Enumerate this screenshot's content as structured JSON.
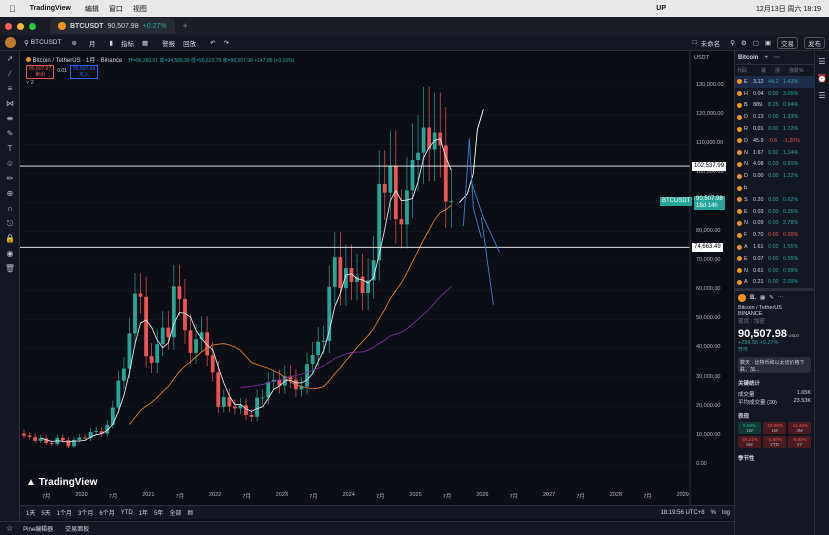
{
  "menubar": {
    "app": "TradingView",
    "items": [
      "编辑",
      "窗口",
      "视图"
    ],
    "status_up": "UP",
    "date_time": "12月13日 周六 18:19"
  },
  "tab": {
    "symbol": "BTCUSDT",
    "price": "90,507.98",
    "change": "+0.27%"
  },
  "toolbar": {
    "symbol": "BTCUSDT",
    "interval": "月",
    "indicators": "指标",
    "alert": "警报",
    "replay": "回放",
    "layout_name": "未命名",
    "trade_button": "交易",
    "publish_button": "发布"
  },
  "legend": {
    "title": "Bitcoin / TetherUS · 1月 · Binance",
    "ohlc": "开=90,360.01 高=94,588.99 低=90,622.76 收=90,507.98 +147.98 (+0.16%)",
    "sell_price": "90,507.97",
    "sell_label": "卖出",
    "spread": "0.01",
    "buy_price": "90,507.98",
    "buy_label": "买入",
    "indicator_count": "2"
  },
  "price_axis": {
    "currency": "USDT",
    "labels": [
      "130,000.00",
      "120,000.00",
      "110,000.00",
      "100,000.00",
      "90,000.00",
      "80,000.00",
      "70,000.00",
      "60,000.00",
      "50,000.00",
      "40,000.00",
      "30,000.00",
      "20,000.00",
      "10,000.00",
      "0.00"
    ],
    "line1": "102,537.99",
    "line2": "74,663.49",
    "current_symbol": "BTCUSDT",
    "current_price": "90,507.98",
    "countdown": "18d 14h"
  },
  "time_axis": [
    "7月",
    "2020",
    "7月",
    "2021",
    "7月",
    "2022",
    "7月",
    "2023",
    "7月",
    "2024",
    "7月",
    "2025",
    "7月",
    "2026",
    "7月",
    "2027",
    "7月",
    "2028",
    "7月",
    "2029"
  ],
  "watermark": "TradingView",
  "bottombar": {
    "ranges": [
      "1天",
      "5天",
      "1个月",
      "3个月",
      "6个月",
      "YTD",
      "1年",
      "5年",
      "全部"
    ],
    "time": "18:19:56 UTC+8"
  },
  "statusbar": {
    "pine": "Pine编辑器",
    "trading": "交易面板"
  },
  "watchlist": {
    "header": [
      "代码",
      "最",
      "涨",
      "涨跌%"
    ],
    "title": "Bitcoin",
    "rows": [
      {
        "s": "E",
        "p": "3,12",
        "c": "44.2",
        "pct": "1.43%",
        "up": true
      },
      {
        "s": "H",
        "p": "0.04",
        "c": "0.00",
        "pct": "3.05%",
        "up": true
      },
      {
        "s": "B",
        "p": "889.",
        "c": "8.25",
        "pct": "0.94%",
        "up": true
      },
      {
        "s": "D",
        "p": "0.13",
        "c": "0.00",
        "pct": "1.33%",
        "up": true
      },
      {
        "s": "R",
        "p": "0.01",
        "c": "0.00",
        "pct": "1.72%",
        "up": true
      },
      {
        "s": "D",
        "p": "45.9",
        "c": "-0.6",
        "pct": "-1.20%",
        "up": false
      },
      {
        "s": "N",
        "p": "1.67",
        "c": "0.02",
        "pct": "1.14%",
        "up": true
      },
      {
        "s": "N",
        "p": "4.08",
        "c": "0.03",
        "pct": "0.91%",
        "up": true
      },
      {
        "s": "D",
        "p": "0.00",
        "c": "0.00",
        "pct": "1.22%",
        "up": true
      },
      {
        "s": "b",
        "p": "",
        "c": "",
        "pct": "",
        "up": true
      },
      {
        "s": "S",
        "p": "0.20",
        "c": "0.00",
        "pct": "0.62%",
        "up": true
      },
      {
        "s": "E",
        "p": "0.03",
        "c": "0.00",
        "pct": "0.35%",
        "up": true
      },
      {
        "s": "N",
        "p": "0.09",
        "c": "0.00",
        "pct": "2.78%",
        "up": true
      },
      {
        "s": "F",
        "p": "0.70",
        "c": "0.00",
        "pct": "0.00%",
        "up": false
      },
      {
        "s": "A",
        "p": "1.61",
        "c": "0.02",
        "pct": "1.55%",
        "up": true
      },
      {
        "s": "E",
        "p": "0.07",
        "c": "0.00",
        "pct": "0.55%",
        "up": true
      },
      {
        "s": "N",
        "p": "0.61",
        "c": "0.00",
        "pct": "0.99%",
        "up": true
      },
      {
        "s": "A",
        "p": "0.21",
        "c": "0.00",
        "pct": "2.09%",
        "up": true
      }
    ]
  },
  "details": {
    "symbol": "B.",
    "name": "Bitcoin / TetherUS",
    "exchange": "BINANCE",
    "tags": "现货 · 加密",
    "price": "90,507.98",
    "unit": "USDT",
    "change": "+239.56",
    "change_pct": "+0.27%",
    "status": "开市",
    "news": "数天 · 比特币和以太坊价格下跌，加...",
    "key_stats": "关键统计",
    "volume_label": "成交量",
    "volume": "1.65K",
    "avg_volume_label": "平均成交量 (30)",
    "avg_volume": "23.53K",
    "performance": "表现",
    "perf": [
      {
        "v": "5.69%",
        "l": "1W",
        "up": true
      },
      {
        "v": "-18.96%",
        "l": "1M",
        "up": false
      },
      {
        "v": "-21.46%",
        "l": "3M",
        "up": false
      },
      {
        "v": "-16.21%",
        "l": "6M",
        "up": false
      },
      {
        "v": "-3.80%",
        "l": "YTD",
        "up": false
      },
      {
        "v": "-9.92%",
        "l": "1Y",
        "up": false
      }
    ],
    "seasonality": "季节性"
  },
  "colors": {
    "up": "#26a69a",
    "down": "#ef5350",
    "ma_white": "#e0e3eb",
    "ma_orange": "#e07b24",
    "ma_purple": "#7b2c9c",
    "arrow": "#3a7fd5"
  },
  "chart_data": {
    "type": "candlestick",
    "interval": "1M",
    "candles": [
      {
        "t": "2019-07",
        "o": 10800,
        "c": 10080
      },
      {
        "t": "2019-08",
        "o": 10080,
        "c": 9600
      },
      {
        "t": "2019-09",
        "o": 9600,
        "c": 8290
      },
      {
        "t": "2019-10",
        "o": 8290,
        "c": 9150
      },
      {
        "t": "2019-11",
        "o": 9150,
        "c": 7540
      },
      {
        "t": "2019-12",
        "o": 7540,
        "c": 7190
      },
      {
        "t": "2020-01",
        "o": 7190,
        "c": 9350
      },
      {
        "t": "2020-02",
        "o": 9350,
        "c": 8520
      },
      {
        "t": "2020-03",
        "o": 8520,
        "c": 6410
      },
      {
        "t": "2020-04",
        "o": 6410,
        "c": 8620
      },
      {
        "t": "2020-05",
        "o": 8620,
        "c": 9450
      },
      {
        "t": "2020-06",
        "o": 9450,
        "c": 9140
      },
      {
        "t": "2020-07",
        "o": 9140,
        "c": 11340
      },
      {
        "t": "2020-08",
        "o": 11340,
        "c": 11650
      },
      {
        "t": "2020-09",
        "o": 11650,
        "c": 10780
      },
      {
        "t": "2020-10",
        "o": 10780,
        "c": 13790
      },
      {
        "t": "2020-11",
        "o": 13790,
        "c": 19700
      },
      {
        "t": "2020-12",
        "o": 19700,
        "c": 28920
      },
      {
        "t": "2021-01",
        "o": 28920,
        "c": 33090
      },
      {
        "t": "2021-02",
        "o": 33090,
        "c": 45140
      },
      {
        "t": "2021-03",
        "o": 45140,
        "c": 58800
      },
      {
        "t": "2021-04",
        "o": 58800,
        "c": 57700
      },
      {
        "t": "2021-05",
        "o": 57700,
        "c": 37300
      },
      {
        "t": "2021-06",
        "o": 37300,
        "c": 35040
      },
      {
        "t": "2021-07",
        "o": 35040,
        "c": 41460
      },
      {
        "t": "2021-08",
        "o": 41460,
        "c": 47100
      },
      {
        "t": "2021-09",
        "o": 47100,
        "c": 43820
      },
      {
        "t": "2021-10",
        "o": 43820,
        "c": 61300
      },
      {
        "t": "2021-11",
        "o": 61300,
        "c": 56950
      },
      {
        "t": "2021-12",
        "o": 56950,
        "c": 46200
      },
      {
        "t": "2022-01",
        "o": 46200,
        "c": 38470
      },
      {
        "t": "2022-02",
        "o": 38470,
        "c": 43160
      },
      {
        "t": "2022-03",
        "o": 43160,
        "c": 45510
      },
      {
        "t": "2022-04",
        "o": 45510,
        "c": 37630
      },
      {
        "t": "2022-05",
        "o": 37630,
        "c": 31800
      },
      {
        "t": "2022-06",
        "o": 31800,
        "c": 19940
      },
      {
        "t": "2022-07",
        "o": 19940,
        "c": 23290
      },
      {
        "t": "2022-08",
        "o": 23290,
        "c": 20050
      },
      {
        "t": "2022-09",
        "o": 20050,
        "c": 19420
      },
      {
        "t": "2022-10",
        "o": 19420,
        "c": 20490
      },
      {
        "t": "2022-11",
        "o": 20490,
        "c": 17160
      },
      {
        "t": "2022-12",
        "o": 17160,
        "c": 16540
      },
      {
        "t": "2023-01",
        "o": 16540,
        "c": 23120
      },
      {
        "t": "2023-02",
        "o": 23120,
        "c": 23140
      },
      {
        "t": "2023-03",
        "o": 23140,
        "c": 28470
      },
      {
        "t": "2023-04",
        "o": 28470,
        "c": 29230
      },
      {
        "t": "2023-05",
        "o": 29230,
        "c": 27210
      },
      {
        "t": "2023-06",
        "o": 27210,
        "c": 30470
      },
      {
        "t": "2023-07",
        "o": 30470,
        "c": 29230
      },
      {
        "t": "2023-08",
        "o": 29230,
        "c": 25940
      },
      {
        "t": "2023-09",
        "o": 25940,
        "c": 26960
      },
      {
        "t": "2023-10",
        "o": 26960,
        "c": 34640
      },
      {
        "t": "2023-11",
        "o": 34640,
        "c": 37720
      },
      {
        "t": "2023-12",
        "o": 37720,
        "c": 42280
      },
      {
        "t": "2024-01",
        "o": 42280,
        "c": 42580
      },
      {
        "t": "2024-02",
        "o": 42580,
        "c": 61130
      },
      {
        "t": "2024-03",
        "o": 61130,
        "c": 71280
      },
      {
        "t": "2024-04",
        "o": 71280,
        "c": 60670
      },
      {
        "t": "2024-05",
        "o": 60670,
        "c": 67540
      },
      {
        "t": "2024-06",
        "o": 67540,
        "c": 62770
      },
      {
        "t": "2024-07",
        "o": 62770,
        "c": 64630
      },
      {
        "t": "2024-08",
        "o": 64630,
        "c": 58970
      },
      {
        "t": "2024-09",
        "o": 58970,
        "c": 63330
      },
      {
        "t": "2024-10",
        "o": 63330,
        "c": 70220
      },
      {
        "t": "2024-11",
        "o": 70220,
        "c": 96410
      },
      {
        "t": "2024-12",
        "o": 96410,
        "c": 93430
      },
      {
        "t": "2025-01",
        "o": 93430,
        "c": 102430
      },
      {
        "t": "2025-02",
        "o": 102430,
        "c": 84350
      },
      {
        "t": "2025-03",
        "o": 84350,
        "c": 82550
      },
      {
        "t": "2025-04",
        "o": 82550,
        "c": 94210
      },
      {
        "t": "2025-05",
        "o": 94210,
        "c": 104590
      },
      {
        "t": "2025-06",
        "o": 104590,
        "c": 107130
      },
      {
        "t": "2025-07",
        "o": 107130,
        "c": 115760
      },
      {
        "t": "2025-08",
        "o": 115760,
        "c": 108250
      },
      {
        "t": "2025-09",
        "o": 108250,
        "c": 114050
      },
      {
        "t": "2025-10",
        "o": 114050,
        "c": 109600
      },
      {
        "t": "2025-11",
        "o": 109600,
        "c": 90360
      },
      {
        "t": "2025-12",
        "o": 90360,
        "c": 90508
      }
    ],
    "horizontal_lines": [
      102537.99,
      74663.49
    ],
    "ylim": [
      -5000,
      135000
    ]
  }
}
